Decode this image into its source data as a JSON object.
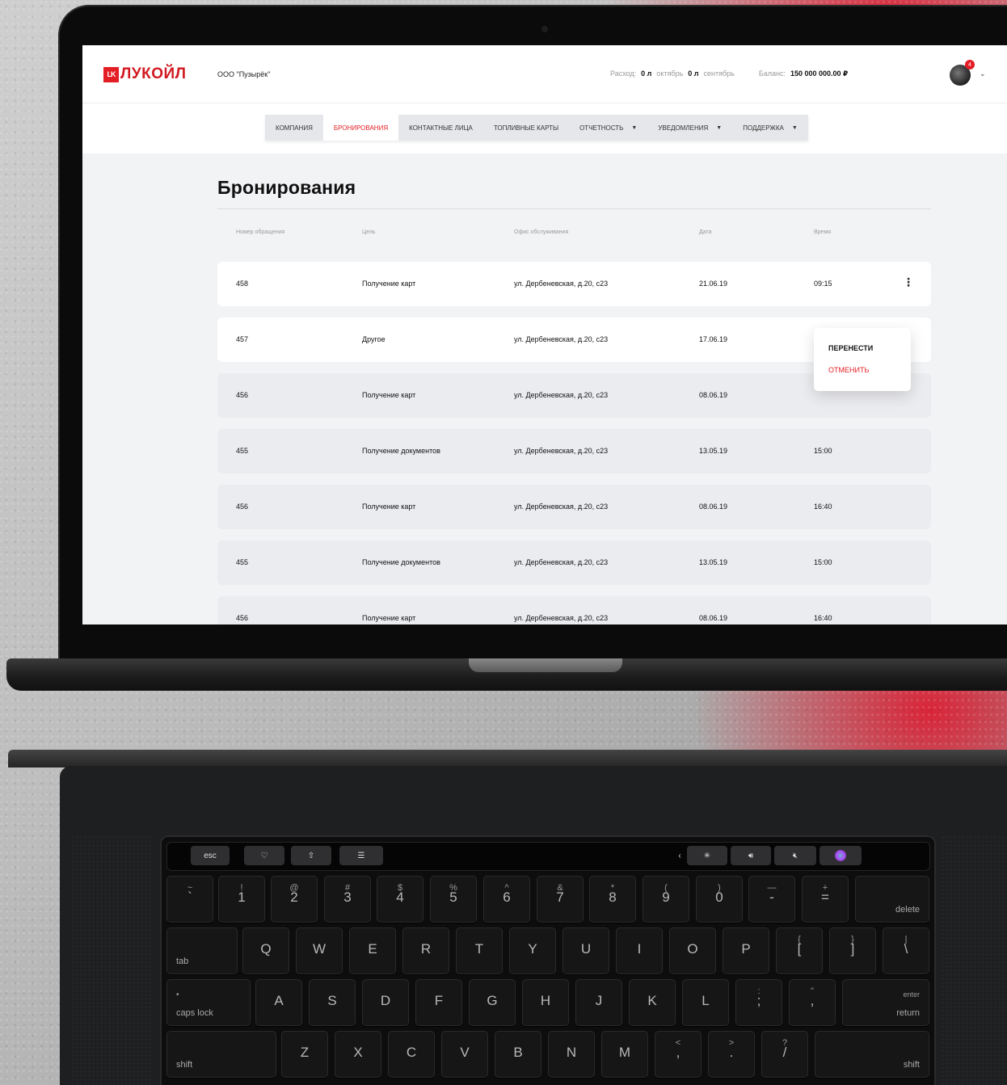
{
  "header": {
    "logo_mark": "LK",
    "logo_text": "ЛУКОЙЛ",
    "company": "ООО \"Пузырёк\"",
    "expense_label": "Расход:",
    "expense_oct_value": "0 л",
    "expense_oct_month": "октябрь",
    "expense_sep_value": "0 л",
    "expense_sep_month": "сентябрь",
    "balance_label": "Баланс:",
    "balance_value": "150 000 000.00 ₽",
    "notifications_count": "4"
  },
  "nav": {
    "items": [
      {
        "label": "КОМПАНИЯ"
      },
      {
        "label": "БРОНИРОВАНИЯ"
      },
      {
        "label": "КОНТАКТНЫЕ ЛИЦА"
      },
      {
        "label": "ТОПЛИВНЫЕ КАРТЫ"
      },
      {
        "label": "ОТЧЕТНОСТЬ"
      },
      {
        "label": "УВЕДОМЛЕНИЯ"
      },
      {
        "label": "ПОДДЕРЖКА"
      }
    ],
    "active_index": 1
  },
  "page": {
    "title": "Бронирования",
    "columns": [
      "Номер обращения",
      "Цель",
      "Офис обслуживания",
      "Дата",
      "Время"
    ],
    "rows": [
      {
        "id": "458",
        "purpose": "Получение карт",
        "office": "ул. Дербеневская, д.20, с23",
        "date": "21.06.19",
        "time": "09:15"
      },
      {
        "id": "457",
        "purpose": "Другое",
        "office": "ул. Дербеневская, д.20, с23",
        "date": "17.06.19",
        "time": ""
      },
      {
        "id": "456",
        "purpose": "Получение карт",
        "office": "ул. Дербеневская, д.20, с23",
        "date": "08.06.19",
        "time": ""
      },
      {
        "id": "455",
        "purpose": "Получение документов",
        "office": "ул. Дербеневская, д.20, с23",
        "date": "13.05.19",
        "time": "15:00"
      },
      {
        "id": "456",
        "purpose": "Получение карт",
        "office": "ул. Дербеневская, д.20, с23",
        "date": "08.06.19",
        "time": "16:40"
      },
      {
        "id": "455",
        "purpose": "Получение документов",
        "office": "ул. Дербеневская, д.20, с23",
        "date": "13.05.19",
        "time": "15:00"
      },
      {
        "id": "456",
        "purpose": "Получение карт",
        "office": "ул. Дербеневская, д.20, с23",
        "date": "08.06.19",
        "time": "16:40"
      }
    ],
    "context_menu": {
      "move": "ПЕРЕНЕСТИ",
      "cancel": "ОТМЕНИТЬ"
    }
  },
  "keyboard": {
    "touchbar": {
      "esc": "esc"
    },
    "num_row": [
      {
        "top": "~",
        "bottom": "`"
      },
      {
        "top": "!",
        "bottom": "1"
      },
      {
        "top": "@",
        "bottom": "2"
      },
      {
        "top": "#",
        "bottom": "3"
      },
      {
        "top": "$",
        "bottom": "4"
      },
      {
        "top": "%",
        "bottom": "5"
      },
      {
        "top": "^",
        "bottom": "6"
      },
      {
        "top": "&",
        "bottom": "7"
      },
      {
        "top": "*",
        "bottom": "8"
      },
      {
        "top": "(",
        "bottom": "9"
      },
      {
        "top": ")",
        "bottom": "0"
      },
      {
        "top": "—",
        "bottom": "-"
      },
      {
        "top": "+",
        "bottom": "="
      }
    ],
    "delete": "delete",
    "tab": "tab",
    "row_q": [
      "Q",
      "W",
      "E",
      "R",
      "T",
      "Y",
      "U",
      "I",
      "O",
      "P"
    ],
    "brackets": [
      {
        "top": "{",
        "bottom": "["
      },
      {
        "top": "}",
        "bottom": "]"
      },
      {
        "top": "|",
        "bottom": "\\"
      }
    ],
    "caps": "caps lock",
    "row_a": [
      "A",
      "S",
      "D",
      "F",
      "G",
      "H",
      "J",
      "K",
      "L"
    ],
    "semis": [
      {
        "top": ":",
        "bottom": ";"
      },
      {
        "top": "\"",
        "bottom": ","
      }
    ],
    "enter": "enter",
    "return": "return",
    "shift": "shift",
    "row_z": [
      "Z",
      "X",
      "C",
      "V",
      "B",
      "N",
      "M"
    ],
    "punct": [
      {
        "top": "<",
        "bottom": ","
      },
      {
        "top": ">",
        "bottom": "."
      },
      {
        "top": "?",
        "bottom": "/"
      }
    ]
  },
  "colors": {
    "brand_red": "#e31e24"
  }
}
